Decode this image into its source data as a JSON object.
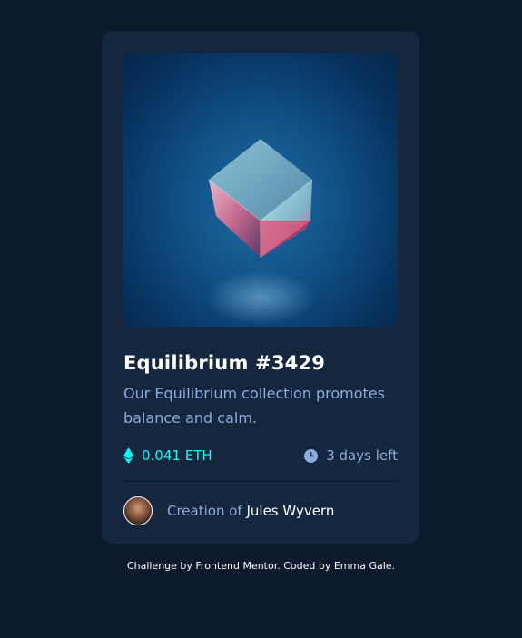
{
  "card": {
    "image_alt": "Equilibrium cube",
    "title": "Equilibrium #3429",
    "description": "Our Equilibrium collection promotes balance and calm.",
    "price": "0.041 ETH",
    "time_left": "3 days left",
    "creator_prefix": "Creation of",
    "creator_name": "Jules Wyvern"
  },
  "footer": {
    "text": "Challenge by Frontend Mentor. Coded by Emma Gale."
  },
  "colors": {
    "page_bg": "#0d192c",
    "card_bg": "#15263f",
    "cyan": "#00fff8",
    "soft_blue": "#8bacd9",
    "white": "#ffffff"
  },
  "icons": {
    "price": "ethereum-icon",
    "time": "clock-icon"
  }
}
